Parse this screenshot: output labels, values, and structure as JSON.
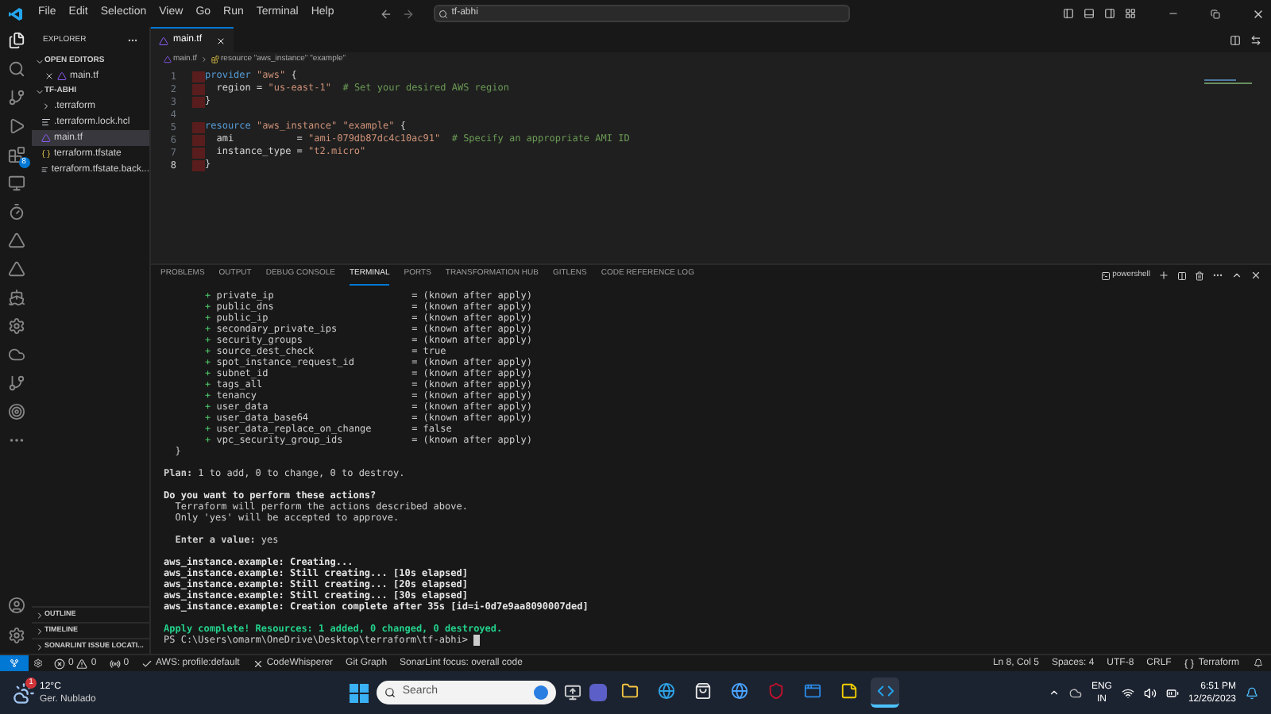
{
  "title_bar": {
    "menu": [
      "File",
      "Edit",
      "Selection",
      "View",
      "Go",
      "Run",
      "Terminal",
      "Help"
    ],
    "search": "tf-abhi"
  },
  "activity_bar": {
    "items": [
      {
        "kind": "files",
        "selected": true
      },
      {
        "kind": "search",
        "selected": false
      },
      {
        "kind": "git",
        "selected": false
      },
      {
        "kind": "run",
        "selected": false
      },
      {
        "kind": "extensions",
        "selected": false,
        "badge": "8"
      },
      {
        "kind": "remote",
        "selected": false
      },
      {
        "kind": "timer",
        "selected": false
      },
      {
        "kind": "terraform",
        "selected": false
      },
      {
        "kind": "terraform",
        "selected": false
      },
      {
        "kind": "docker",
        "selected": false
      },
      {
        "kind": "gear",
        "selected": false
      },
      {
        "kind": "aws",
        "selected": false
      },
      {
        "kind": "git",
        "selected": false
      },
      {
        "kind": "sonar",
        "selected": false
      },
      {
        "kind": "more",
        "selected": false
      }
    ],
    "bottom": [
      {
        "kind": "account"
      },
      {
        "kind": "gear"
      }
    ]
  },
  "sidebar": {
    "title": "EXPLORER",
    "sections": [
      {
        "label": "OPEN EDITORS",
        "expanded": true,
        "items": [
          {
            "label": "main.tf",
            "kind": "tf",
            "selected": false,
            "closable": true
          }
        ]
      },
      {
        "label": "TF-ABHI",
        "expanded": true,
        "items": [
          {
            "label": ".terraform",
            "kind": "folder",
            "selected": false
          },
          {
            "label": ".terraform.lock.hcl",
            "kind": "lines",
            "selected": false
          },
          {
            "label": "main.tf",
            "kind": "tf",
            "selected": true
          },
          {
            "label": "terraform.tfstate",
            "kind": "json",
            "selected": false
          },
          {
            "label": "terraform.tfstate.back...",
            "kind": "lines",
            "selected": false
          }
        ]
      }
    ],
    "bottom_sections": [
      {
        "label": "OUTLINE",
        "expanded": false
      },
      {
        "label": "TIMELINE",
        "expanded": false
      },
      {
        "label": "SONARLINT ISSUE LOCATI...",
        "expanded": false
      }
    ]
  },
  "editor": {
    "tab": "main.tf",
    "breadcrumb": [
      "main.tf",
      "resource \"aws_instance\" \"example\""
    ],
    "lines": [
      {
        "number": "1",
        "highlighted": true,
        "tokens": [
          {
            "kind": "keyword",
            "text": "provider "
          },
          {
            "kind": "string",
            "text": "\"aws\""
          },
          {
            "kind": "plain",
            "text": " {"
          }
        ]
      },
      {
        "number": "2",
        "highlighted": true,
        "tokens": [
          {
            "kind": "plain",
            "text": "  region = "
          },
          {
            "kind": "string",
            "text": "\"us-east-1\""
          },
          {
            "kind": "comment",
            "text": "  # Set your desired AWS region"
          }
        ]
      },
      {
        "number": "3",
        "highlighted": true,
        "tokens": [
          {
            "kind": "plain",
            "text": "}"
          }
        ]
      },
      {
        "number": "4",
        "highlighted": false
      },
      {
        "number": "5",
        "highlighted": true,
        "tokens": [
          {
            "kind": "keyword",
            "text": "resource "
          },
          {
            "kind": "string",
            "text": "\"aws_instance\" \"example\""
          },
          {
            "kind": "plain",
            "text": " {"
          }
        ]
      },
      {
        "number": "6",
        "highlighted": true,
        "tokens": [
          {
            "kind": "plain",
            "text": "  ami           = "
          },
          {
            "kind": "string",
            "text": "\"ami-079db87dc4c10ac91\""
          },
          {
            "kind": "comment",
            "text": "  # Specify an appropriate AMI ID"
          }
        ]
      },
      {
        "number": "7",
        "highlighted": true,
        "tokens": [
          {
            "kind": "plain",
            "text": "  instance_type = "
          },
          {
            "kind": "string",
            "text": "\"t2.micro\""
          }
        ]
      },
      {
        "number": "8",
        "highlighted": true,
        "tokens": [
          {
            "kind": "plain",
            "text": "}"
          }
        ]
      }
    ]
  },
  "panel": {
    "tabs": [
      {
        "label": "PROBLEMS",
        "selected": false
      },
      {
        "label": "OUTPUT",
        "selected": false
      },
      {
        "label": "DEBUG CONSOLE",
        "selected": false
      },
      {
        "label": "TERMINAL",
        "selected": true
      },
      {
        "label": "PORTS",
        "selected": false
      },
      {
        "label": "TRANSFORMATION HUB",
        "selected": false
      },
      {
        "label": "GITLENS",
        "selected": false
      },
      {
        "label": "CODE REFERENCE LOG",
        "selected": false
      }
    ],
    "shell": "powershell",
    "terminal": [
      {
        "kind": "attr",
        "sign": "+",
        "name": "private_ip",
        "value": "= (known after apply)"
      },
      {
        "kind": "attr",
        "sign": "+",
        "name": "public_dns",
        "value": "= (known after apply)"
      },
      {
        "kind": "attr",
        "sign": "+",
        "name": "public_ip",
        "value": "= (known after apply)"
      },
      {
        "kind": "attr",
        "sign": "+",
        "name": "secondary_private_ips",
        "value": "= (known after apply)"
      },
      {
        "kind": "attr",
        "sign": "+",
        "name": "security_groups",
        "value": "= (known after apply)"
      },
      {
        "kind": "attr",
        "sign": "+",
        "name": "source_dest_check",
        "value": "= true"
      },
      {
        "kind": "attr",
        "sign": "+",
        "name": "spot_instance_request_id",
        "value": "= (known after apply)"
      },
      {
        "kind": "attr",
        "sign": "+",
        "name": "subnet_id",
        "value": "= (known after apply)"
      },
      {
        "kind": "attr",
        "sign": "+",
        "name": "tags_all",
        "value": "= (known after apply)"
      },
      {
        "kind": "attr",
        "sign": "+",
        "name": "tenancy",
        "value": "= (known after apply)"
      },
      {
        "kind": "attr",
        "sign": "+",
        "name": "user_data",
        "value": "= (known after apply)"
      },
      {
        "kind": "attr",
        "sign": "+",
        "name": "user_data_base64",
        "value": "= (known after apply)"
      },
      {
        "kind": "attr",
        "sign": "+",
        "name": "user_data_replace_on_change",
        "value": "= false"
      },
      {
        "kind": "attr",
        "sign": "+",
        "name": "vpc_security_group_ids",
        "value": "= (known after apply)"
      },
      {
        "kind": "plain",
        "text": "  }"
      },
      {
        "kind": "blank"
      },
      {
        "kind": "plain",
        "text": "**Plan:** 1 to add, 0 to change, 0 to destroy."
      },
      {
        "kind": "blank"
      },
      {
        "kind": "bold",
        "text": "Do you want to perform these actions?"
      },
      {
        "kind": "plain",
        "text": "  Terraform will perform the actions described above."
      },
      {
        "kind": "plain",
        "text": "  Only 'yes' will be accepted to approve."
      },
      {
        "kind": "blank"
      },
      {
        "kind": "plain",
        "text": "  **Enter a value:** yes"
      },
      {
        "kind": "blank"
      },
      {
        "kind": "bold",
        "text": "aws_instance.example: Creating..."
      },
      {
        "kind": "bold",
        "text": "aws_instance.example: Still creating... [10s elapsed]"
      },
      {
        "kind": "bold",
        "text": "aws_instance.example: Still creating... [20s elapsed]"
      },
      {
        "kind": "bold",
        "text": "aws_instance.example: Still creating... [30s elapsed]"
      },
      {
        "kind": "bold",
        "text": "aws_instance.example: Creation complete after 35s [id=i-0d7e9aa8090007ded]"
      },
      {
        "kind": "blank"
      },
      {
        "kind": "success",
        "text": "Apply complete! Resources: 1 added, 0 changed, 0 destroyed."
      },
      {
        "kind": "prompt",
        "text": "PS C:\\Users\\omarm\\OneDrive\\Desktop\\terraform\\tf-abhi> "
      }
    ]
  },
  "status_bar": {
    "left": [
      {
        "kind": "errors",
        "text": "0",
        "text2": "0"
      },
      {
        "kind": "ports",
        "text": "0"
      },
      {
        "kind": "check",
        "text": "AWS: profile:default"
      },
      {
        "kind": "cross",
        "text": "CodeWhisperer"
      },
      {
        "kind": "plain",
        "text": "Git Graph"
      },
      {
        "kind": "plain",
        "text": "SonarLint focus: overall code"
      }
    ],
    "right": [
      {
        "kind": "plain",
        "text": "Ln 8, Col 5"
      },
      {
        "kind": "plain",
        "text": "Spaces: 4"
      },
      {
        "kind": "plain",
        "text": "UTF-8"
      },
      {
        "kind": "plain",
        "text": "CRLF"
      },
      {
        "kind": "braces",
        "text": "Terraform"
      }
    ]
  },
  "taskbar": {
    "weather": {
      "temp": "12°C",
      "condition": "Ger. Nublado",
      "badge": "1"
    },
    "search": "Search",
    "apps": [
      {
        "kind": "folder",
        "selected": false
      },
      {
        "kind": "browser",
        "selected": false
      },
      {
        "kind": "store",
        "selected": false
      },
      {
        "kind": "globe",
        "selected": false
      },
      {
        "kind": "shield",
        "selected": false
      },
      {
        "kind": "window",
        "selected": false
      },
      {
        "kind": "note",
        "selected": false
      },
      {
        "kind": "code",
        "selected": true
      }
    ],
    "language": "ENG",
    "region": "IN",
    "time": "6:51 PM",
    "date": "12/26/2023"
  }
}
